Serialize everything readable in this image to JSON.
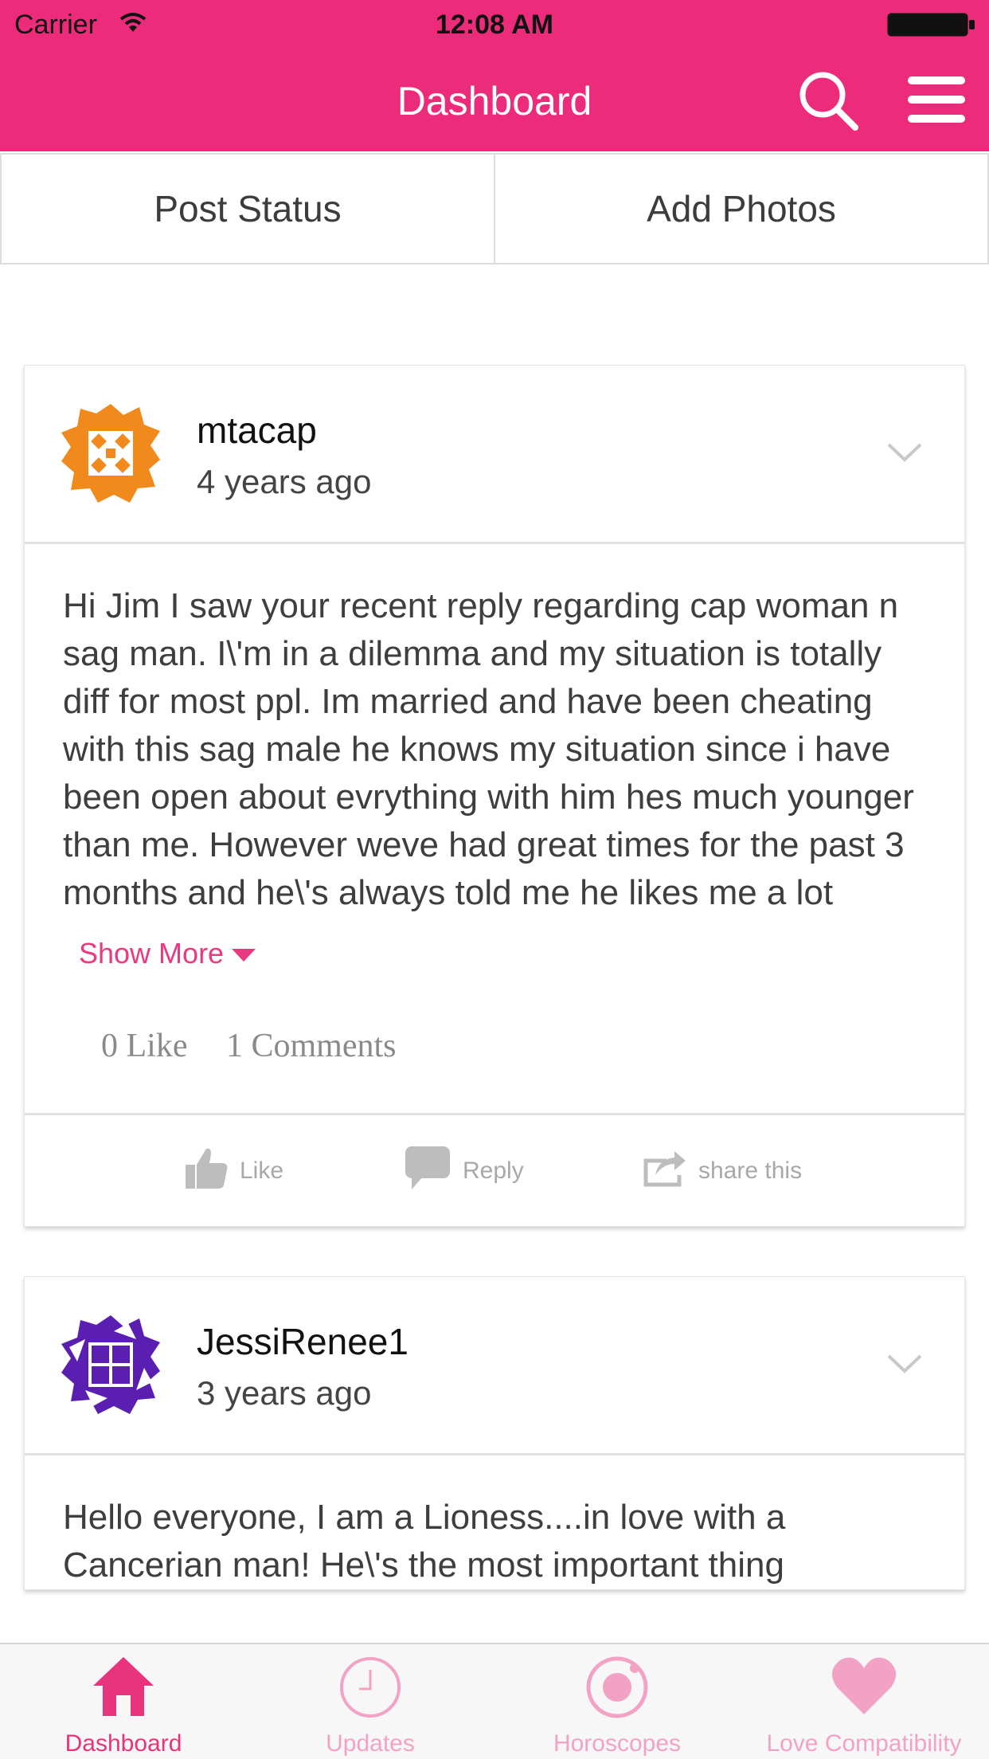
{
  "status_bar": {
    "carrier": "Carrier",
    "time": "12:08 AM"
  },
  "nav": {
    "title": "Dashboard",
    "accent": "#ec2c7a"
  },
  "actions": {
    "post_status": "Post Status",
    "add_photos": "Add Photos"
  },
  "posts": [
    {
      "username": "mtacap",
      "time": "4 years ago",
      "avatar_color": "#f08a1c",
      "body": "Hi Jim I saw your recent reply regarding cap woman n sag man. I\\'m in a dilemma and my situation is totally diff for most ppl. Im married and have been cheating with this sag male he knows my situation since i have been open about evrything with him hes much younger than me. However weve had great times for the past 3 months and he\\'s always told me he likes me a lot",
      "show_more": "Show More",
      "likes": "0 Like",
      "comments": "1 Comments",
      "actions": {
        "like": "Like",
        "reply": "Reply",
        "share": "share this"
      }
    },
    {
      "username": "JessiRenee1",
      "time": "3 years ago",
      "avatar_color": "#5a1fb0",
      "body": "Hello everyone, I am a Lioness....in love with a Cancerian man! He\\'s the most important thing"
    }
  ],
  "tabs": [
    {
      "label": "Dashboard",
      "icon": "home-icon",
      "active": true
    },
    {
      "label": "Updates",
      "icon": "clock-icon",
      "active": false
    },
    {
      "label": "Horoscopes",
      "icon": "horoscope-icon",
      "active": false
    },
    {
      "label": "Love Compatibility",
      "icon": "heart-icon",
      "active": false
    }
  ],
  "colors": {
    "active_tab": "#e8337d",
    "inactive_tab": "#f2a3c5",
    "link": "#e83a82"
  }
}
